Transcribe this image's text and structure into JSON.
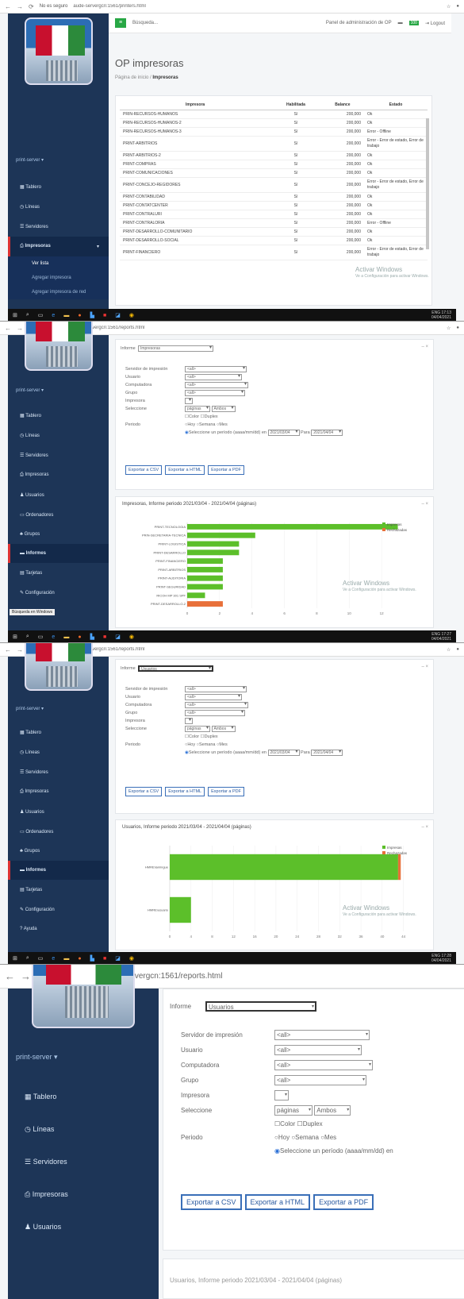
{
  "browser": {
    "not_secure": "No es seguro",
    "url_printers": "aude-servergcn:1561/printers.html",
    "url_reports": "aude-servergcn:1561/reports.html"
  },
  "sidebar": {
    "user": "print-server ▾",
    "items": [
      "Tablero",
      "Líneas",
      "Servidores",
      "Impresoras",
      "Usuarios",
      "Ordenadores",
      "Grupos",
      "Informes",
      "Tarjetas",
      "Configuración",
      "Ayuda"
    ],
    "printers_sub": [
      "Ver lista",
      "Agregar impresora",
      "Agregar impresora de red"
    ]
  },
  "topbar": {
    "search_placeholder": "Búsqueda...",
    "admin_panel": "Panel de administración de OP",
    "badge": "100",
    "logout": "Logout"
  },
  "printers_page": {
    "title": "OP impresoras",
    "crumb_home": "Página de inicio /",
    "crumb_current": "Impresoras",
    "columns": [
      "Impresora",
      "Habilitada",
      "Balance",
      "Estado"
    ],
    "rows": [
      [
        "PRIN-RECURSOS-HUMANOS",
        "Sí",
        "200,000",
        "Ok"
      ],
      [
        "PRIN-RECURSOS-HUMANOS-2",
        "Sí",
        "200,000",
        "Ok"
      ],
      [
        "PRIN-RECURSOS-HUMANOS-3",
        "Sí",
        "200,000",
        "Error - Offline"
      ],
      [
        "PRINT-ARBITRIOS",
        "Sí",
        "200,000",
        "Error - Error de estado, Error de trabajo"
      ],
      [
        "PRINT-ARBITRIOS-2",
        "Sí",
        "200,000",
        "Ok"
      ],
      [
        "PRINT-COMPRAS",
        "Sí",
        "200,000",
        "Ok"
      ],
      [
        "PRINT-COMUNICACIONES",
        "Sí",
        "200,000",
        "Ok"
      ],
      [
        "PRINT-CONCEJO-REGIDORES",
        "Sí",
        "200,000",
        "Error - Error de estado, Error de trabajo"
      ],
      [
        "PRINT-CONTABILIDAD",
        "Sí",
        "200,000",
        "Ok"
      ],
      [
        "PRINT-CONTATCENTER",
        "Sí",
        "200,000",
        "Ok"
      ],
      [
        "PRINT-CONTRALURI",
        "Sí",
        "200,000",
        "Ok"
      ],
      [
        "PRINT-CONTRALORIA",
        "Sí",
        "200,000",
        "Error - Offline"
      ],
      [
        "PRINT-DESARROLLO-COMUNITARIO",
        "Sí",
        "200,000",
        "Ok"
      ],
      [
        "PRINT-DESARROLLO-SOCIAL",
        "Sí",
        "200,000",
        "Ok"
      ],
      [
        "PRINT-FINANCIERO",
        "Sí",
        "200,000",
        "Error - Error de estado, Error de trabajo"
      ]
    ]
  },
  "report_form": {
    "informe_label": "Informe",
    "informe_printers": "Impresoras",
    "informe_users": "Usuarios",
    "labels": [
      "Servidor de impresión",
      "Usuario",
      "Computadora",
      "Grupo",
      "Impresora",
      "Seleccione",
      "Periodo"
    ],
    "todo": "<all>",
    "paginas": "páginas",
    "ambos": "Ambos",
    "color": "Color",
    "duplex": "Duplex",
    "hoy": "Hoy",
    "semana": "Semana",
    "mes": "Mes",
    "period_text": "Seleccione un período (aaaa/mm/dd) en",
    "date_from": "2021/03/04",
    "para": "Para",
    "date_to": "2021/04/04",
    "export_csv": "Exportar a CSV",
    "export_html": "Exportar a HTML",
    "export_pdf": "Exportar a PDF"
  },
  "watermark": {
    "title": "Activar Windows",
    "sub": "Ve a Configuración para activar Windows."
  },
  "taskbar": {
    "lang": "ENG",
    "times": [
      "17:13",
      "17:27",
      "17:28"
    ],
    "date": "04/04/2021",
    "search_tooltip": "Búsqueda en Windows"
  },
  "chart_data": [
    {
      "type": "bar",
      "title": "Impresoras, Informe periodo 2021/03/04 - 2021/04/04 (páginas)",
      "categories": [
        "PRINT-TECNOLOGIA",
        "PRIN-SECRETARIA-TECNICA",
        "PRINT-LOGISTICA",
        "PRINT-DESARROLLO",
        "PRINT-FINANCIERO",
        "PRINT-ARBITRIOS",
        "PRINT-AUDITORIA",
        "PRINT-SEGURIDAD",
        "RICOH MP 301 SPF",
        "PRINT-DESARROLLO-2"
      ],
      "series": [
        {
          "name": "Impresas",
          "color": "#5cbf2a",
          "values": [
            13,
            4.2,
            3.2,
            3.2,
            2.2,
            2.2,
            2.2,
            2.2,
            1.1,
            0
          ]
        },
        {
          "name": "Rechazadas",
          "color": "#e8703a",
          "values": [
            0,
            0,
            0,
            0,
            0,
            0,
            0,
            0,
            0,
            2.2
          ]
        }
      ],
      "xlim": [
        0,
        14
      ],
      "xticks": [
        "0",
        "2",
        "4",
        "6",
        "8",
        "10",
        "12"
      ]
    },
    {
      "type": "bar",
      "title": "Usuarios, Informe periodo 2021/03/04 - 2021/04/04 (páginas)",
      "categories": [
        "HMRE\\lamingue",
        "HMRE\\usuario"
      ],
      "series": [
        {
          "name": "Impresas",
          "color": "#5cbf2a",
          "values": [
            43,
            4
          ]
        },
        {
          "name": "Rechazadas",
          "color": "#e8703a",
          "values": [
            0.5,
            0
          ]
        }
      ],
      "xlim": [
        0,
        46
      ],
      "xticks": [
        "0",
        "4",
        "8",
        "12",
        "16",
        "20",
        "24",
        "28",
        "32",
        "36",
        "40",
        "44"
      ]
    }
  ]
}
